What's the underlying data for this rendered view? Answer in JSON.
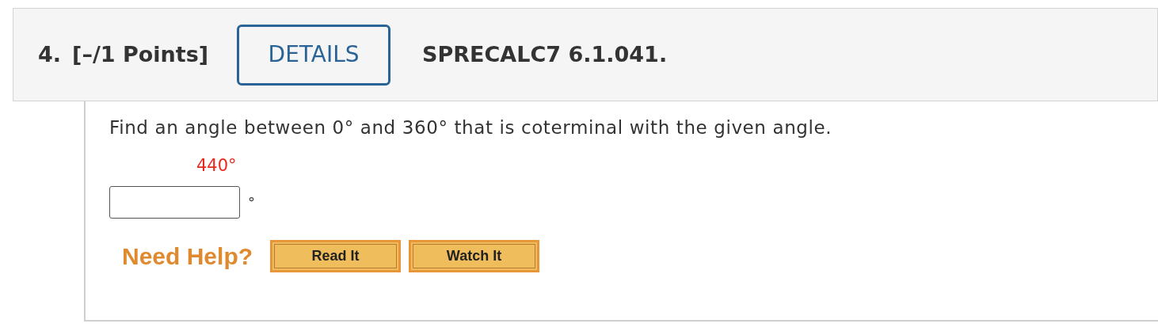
{
  "question": {
    "number": "4.",
    "points": "[–/1 Points]",
    "details_button": "DETAILS",
    "problem_id": "SPRECALC7 6.1.041."
  },
  "body": {
    "prompt": "Find an angle between 0° and 360° that is coterminal with the given angle.",
    "given_angle": "440°",
    "answer": {
      "unit": "°"
    },
    "help_label": "Need Help?",
    "help_buttons": [
      "Read It",
      "Watch It"
    ]
  }
}
